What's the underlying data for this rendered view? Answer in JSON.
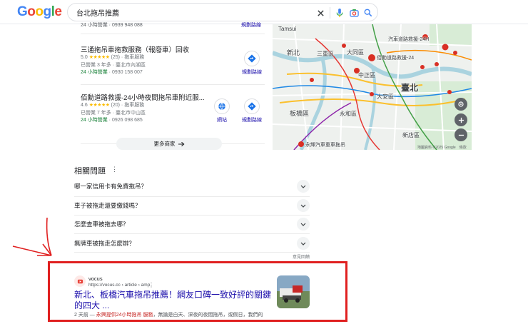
{
  "header": {
    "logo": "Google",
    "search_value": "台北拖吊推薦",
    "colors": {
      "blue": "#4285f4",
      "red": "#ea4335",
      "yellow": "#fbbc05",
      "green": "#34a853"
    }
  },
  "local_results": {
    "cut_row": {
      "hours": "24 小時營業",
      "phone": "0939 948 088",
      "action": "規劃路線"
    },
    "items": [
      {
        "name": "三通拖吊車拖救服務（報廢車）回收",
        "rating": "5.0",
        "stars": "★★★★★",
        "reviews": "(25)",
        "category": "拖車服務",
        "years": "已營業 3 年多",
        "location": "臺北市內湖區",
        "hours": "24 小時營業",
        "phone": "0930 158 007",
        "directions_label": "規劃路線"
      },
      {
        "name": "佰勳道路救援-24小時夜間拖吊車附近服...",
        "rating": "4.6",
        "stars": "★★★★★",
        "reviews": "(20)",
        "category": "拖車服務",
        "years": "已營業 7 年多",
        "location": "臺北市中山區",
        "hours": "24 小時營業",
        "phone": "0926 098 685",
        "website_label": "網站",
        "directions_label": "規劃路線"
      }
    ],
    "more_button": "更多商家"
  },
  "map": {
    "labels": {
      "a": "Tamsui",
      "b": "新北",
      "c": "三重區",
      "d": "大同區",
      "e": "汽車道路救援-24H",
      "f": "佰勳道路救援-24",
      "g": "中正區",
      "h": "大安區",
      "i": "臺北",
      "j": "板橋區",
      "k": "永和區",
      "l": "新店區",
      "m": "永輝汽車重車拖吊"
    },
    "attribution": "地圖資料 ©2025 Google　條款"
  },
  "related": {
    "title": "相關問題",
    "questions": [
      "哪一家信用卡有免費拖吊？",
      "車子被拖走還要繳錢嗎？",
      "怎麼查車被拖去哪？",
      "無牌車被拖走怎麼辦？"
    ],
    "feedback": "意見回饋"
  },
  "result": {
    "site_name": "vocus",
    "url": "https://vocus.cc › article › amp",
    "title": "新北、板橋汽車拖吊推薦！網友口碑一致好評的關鍵的四大 ...",
    "snippet_date": "2 天前 — ",
    "snippet_em": "永興提供24小時拖吊 服務",
    "snippet_rest": "，無論是白天、深夜的夜間拖吊，或假日，我們的"
  },
  "annotation": {
    "color": "#e02020"
  }
}
